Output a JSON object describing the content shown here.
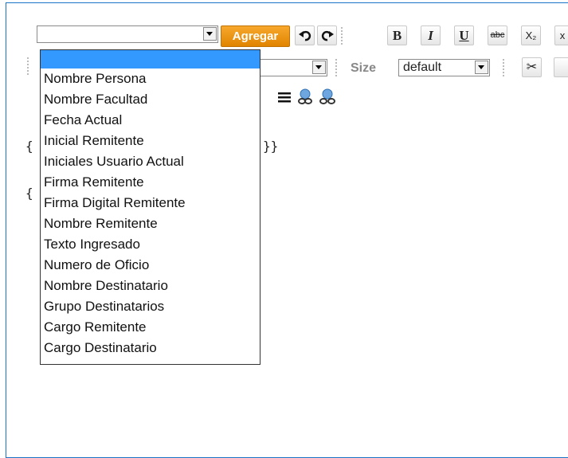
{
  "toolbar": {
    "placeholder_select_value": "",
    "add_button_label": "Agregar",
    "bold_label": "B",
    "italic_label": "I",
    "underline_label": "U",
    "strike_label": "abc",
    "subscript_label": "X₂",
    "size_label": "Size",
    "size_value": "default"
  },
  "editor": {
    "line1": "{",
    "line1_end": "}}",
    "line2": "{"
  },
  "dropdown": {
    "options": [
      "",
      "Nombre Persona",
      "Nombre Facultad",
      "Fecha Actual",
      "Inicial Remitente",
      "Iniciales Usuario Actual",
      "Firma Remitente",
      "Firma Digital Remitente",
      "Nombre Remitente",
      "Texto Ingresado",
      "Numero de Oficio",
      "Nombre Destinatario",
      "Grupo Destinatarios",
      "Cargo Remitente",
      "Cargo Destinatario"
    ],
    "selected_index": 0
  },
  "colors": {
    "accent_orange": "#f29a12",
    "selection_blue": "#3399ff",
    "frame_blue": "#1a73c7"
  },
  "icons": [
    "undo-icon",
    "redo-icon",
    "cut-icon",
    "align-justify-icon",
    "link-icon",
    "unlink-icon"
  ]
}
